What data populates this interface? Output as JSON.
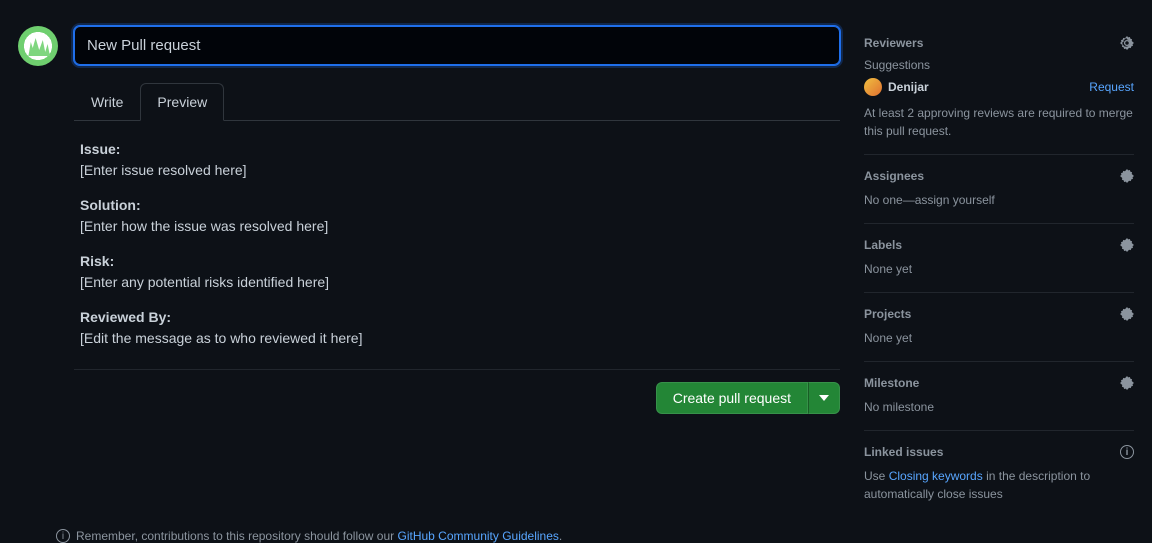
{
  "title_input": {
    "value": "New Pull request"
  },
  "tabs": {
    "write": "Write",
    "preview": "Preview"
  },
  "preview": {
    "sections": [
      {
        "label": "Issue:",
        "placeholder": "[Enter issue resolved here]"
      },
      {
        "label": "Solution:",
        "placeholder": "[Enter how the issue was resolved here]"
      },
      {
        "label": "Risk:",
        "placeholder": "[Enter any potential risks identified here]"
      },
      {
        "label": "Reviewed By:",
        "placeholder": "[Edit the message as to who reviewed it here]"
      }
    ]
  },
  "actions": {
    "create": "Create pull request"
  },
  "note": {
    "prefix": "Remember, contributions to this repository should follow our ",
    "link": "GitHub Community Guidelines",
    "suffix": "."
  },
  "sidebar": {
    "reviewers": {
      "title": "Reviewers",
      "suggestions_label": "Suggestions",
      "suggested": {
        "name": "Denijar",
        "action": "Request"
      },
      "note": "At least 2 approving reviews are required to merge this pull request."
    },
    "assignees": {
      "title": "Assignees",
      "empty_prefix": "No one—",
      "assign_self": "assign yourself"
    },
    "labels": {
      "title": "Labels",
      "empty": "None yet"
    },
    "projects": {
      "title": "Projects",
      "empty": "None yet"
    },
    "milestone": {
      "title": "Milestone",
      "empty": "No milestone"
    },
    "linked": {
      "title": "Linked issues",
      "text_prefix": "Use ",
      "link": "Closing keywords",
      "text_suffix": " in the description to automatically close issues"
    }
  }
}
